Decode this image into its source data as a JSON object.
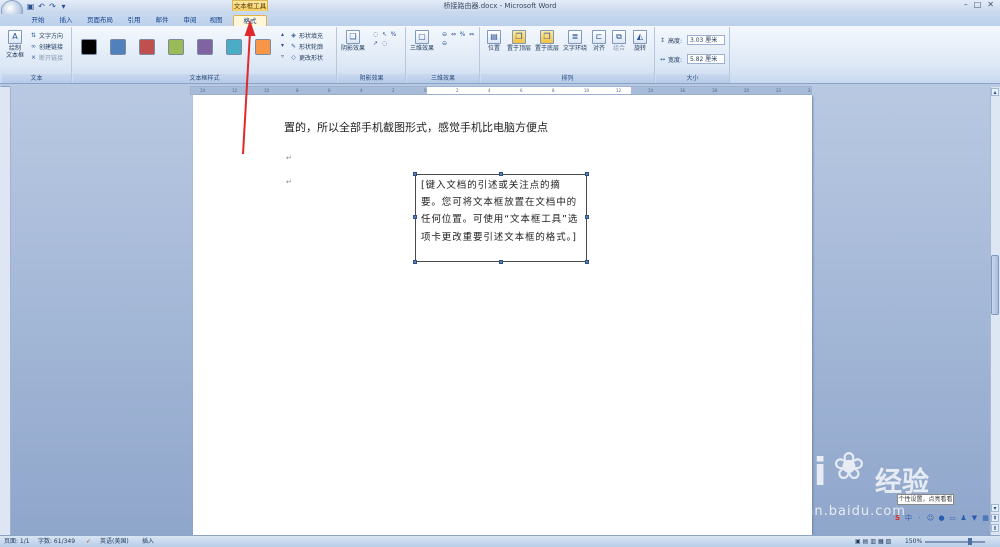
{
  "window": {
    "title": "桥接路由器.docx - Microsoft Word",
    "context_tool": "文本框工具"
  },
  "tabs": [
    "开始",
    "插入",
    "页面布局",
    "引用",
    "邮件",
    "审阅",
    "视图",
    "格式"
  ],
  "ribbon": {
    "text_group": {
      "label": "文本",
      "draw_textbox": "绘制\n文本框",
      "text_direction": "文字方向",
      "create_link": "创建链接",
      "break_link": "断开链接"
    },
    "styles_group": {
      "label": "文本框样式",
      "swatches": [
        "#000000",
        "#4f81bd",
        "#c0504d",
        "#9bbb59",
        "#8064a2",
        "#4bacc6",
        "#f79646"
      ],
      "shape_fill": "形状填充",
      "shape_outline": "形状轮廓",
      "change_shape": "更改形状"
    },
    "shadow_group": {
      "label": "阴影效果",
      "button": "阴影效果"
    },
    "threed_group": {
      "label": "三维效果",
      "button": "三维效果"
    },
    "arrange_group": {
      "label": "排列",
      "position": "位置",
      "bring_front": "置于顶层",
      "send_back": "置于底层",
      "wrap": "文字环绕",
      "align": "对齐",
      "group": "组合",
      "rotate": "旋转"
    },
    "size_group": {
      "label": "大小",
      "height_label": "高度:",
      "height_value": "3.03 厘米",
      "width_label": "宽度:",
      "width_value": "5.82 厘米"
    }
  },
  "document": {
    "line1": "置的，所以全部手机截图形式，感觉手机比电脑方便点",
    "textbox": "[键入文档的引述或关注点的摘要。您可将文本框放置在文档中的任何位置。可使用“文本框工具”选项卡更改重要引述文本框的格式。]"
  },
  "status": {
    "page": "页面: 1/1",
    "words": "字数: 61/349",
    "language": "英语(美国)",
    "mode": "插入",
    "zoom": "150%"
  },
  "tooltip": "个性设置，点亮看看",
  "watermark": {
    "brand": "Bai",
    "brand_cn": "经验",
    "url": "jingyan.baidu.com"
  },
  "colors": {
    "accent": "#e3b14e",
    "arrow": "#e0282d"
  }
}
